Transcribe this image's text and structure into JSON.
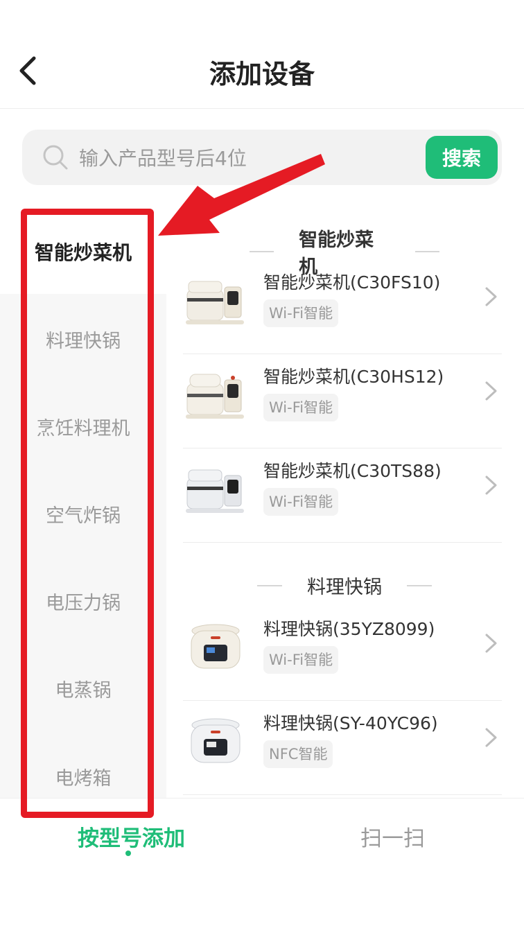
{
  "header": {
    "title": "添加设备"
  },
  "search": {
    "placeholder": "输入产品型号后4位",
    "button_label": "搜索"
  },
  "categories": [
    "智能炒菜机",
    "料理快锅",
    "烹饪料理机",
    "空气炸锅",
    "电压力锅",
    "电蒸锅",
    "电烤箱"
  ],
  "sections": [
    {
      "title": "智能炒菜机",
      "items": [
        {
          "name": "智能炒菜机(C30FS10)",
          "badge": "Wi-Fi智能"
        },
        {
          "name": "智能炒菜机(C30HS12)",
          "badge": "Wi-Fi智能"
        },
        {
          "name": "智能炒菜机(C30TS88)",
          "badge": "Wi-Fi智能"
        }
      ]
    },
    {
      "title": "料理快锅",
      "items": [
        {
          "name": "料理快锅(35YZ8099)",
          "badge": "Wi-Fi智能"
        },
        {
          "name": "料理快锅(SY-40YC96)",
          "badge": "NFC智能"
        }
      ]
    }
  ],
  "tabs": {
    "by_model": "按型号添加",
    "scan": "扫一扫"
  },
  "colors": {
    "accent": "#1fbd78",
    "highlight": "#e51b24"
  }
}
